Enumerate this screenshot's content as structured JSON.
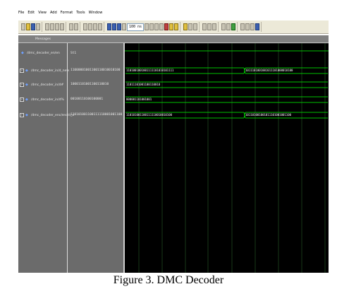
{
  "menu": [
    "File",
    "Edit",
    "View",
    "Add",
    "Format",
    "Tools",
    "Window"
  ],
  "toolbar": {
    "zoom_value": "100 ns"
  },
  "wave_panel": {
    "header_label": "Messages"
  },
  "signals": [
    {
      "name": "/dmc_decoder_en/en",
      "value": "St1",
      "has_expand": false,
      "wave_segments": [
        "",
        ""
      ]
    },
    {
      "name": "/dmc_decoder_in/d_new",
      "value": "11000001001100110010010100",
      "has_expand": true,
      "wave_segments": [
        "1101001001001111101010101111",
        "1011101001001011101000010100"
      ]
    },
    {
      "name": "/dmc_decoder_in/d#",
      "value": "10001101001100110010",
      "has_expand": true,
      "wave_segments": [
        "11011101001100110010",
        ""
      ]
    },
    {
      "name": "/dmc_decoder_in/d%",
      "value": "00100110100100001",
      "has_expand": true,
      "wave_segments": [
        "000001101001001",
        ""
      ]
    },
    {
      "name": "/dmc_decoder_enc/enc/d_o",
      "value": "110101001100111110001001100",
      "has_expand": true,
      "wave_segments": [
        "110101001100111110010010100",
        "101101001001011101001001100"
      ]
    }
  ],
  "caption": "Figure 3. DMC Decoder",
  "colors": {
    "wave": "#00ff00",
    "background": "#000000",
    "panel": "#6b6b6b",
    "grid": "#2f6f2f"
  }
}
